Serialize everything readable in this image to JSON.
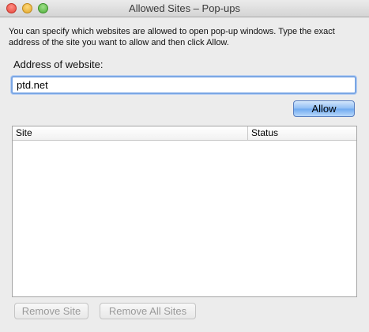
{
  "window": {
    "title": "Allowed Sites – Pop-ups"
  },
  "intro_text": "You can specify which websites are allowed to open pop-up windows. Type the exact address of the site you want to allow and then click Allow.",
  "address": {
    "label": "Address of website:",
    "value": "ptd.net"
  },
  "allow_button": "Allow",
  "table": {
    "columns": [
      "Site",
      "Status"
    ],
    "rows": []
  },
  "buttons": {
    "remove_site": "Remove Site",
    "remove_all_sites": "Remove All Sites"
  }
}
